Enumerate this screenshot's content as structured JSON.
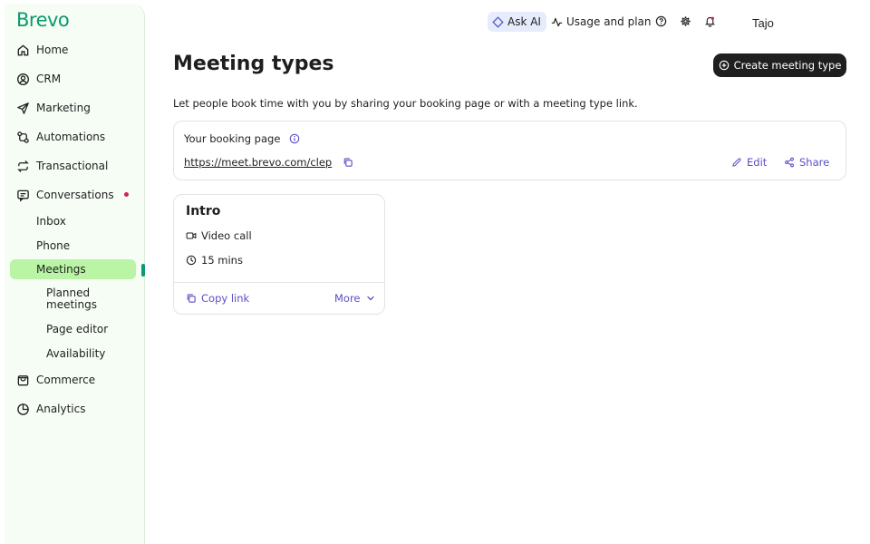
{
  "brand": {
    "logo": "Brevo",
    "color": "#0b996e"
  },
  "sidebar": {
    "items": [
      {
        "label": "Home",
        "icon": "home-icon"
      },
      {
        "label": "CRM",
        "icon": "contacts-icon"
      },
      {
        "label": "Marketing",
        "icon": "send-icon"
      },
      {
        "label": "Automations",
        "icon": "automation-icon"
      },
      {
        "label": "Transactional",
        "icon": "repeat-icon"
      },
      {
        "label": "Conversations",
        "icon": "chat-icon",
        "notification": true
      },
      {
        "label": "Commerce",
        "icon": "bag-icon"
      },
      {
        "label": "Analytics",
        "icon": "pie-chart-icon"
      }
    ],
    "conversations_sub": [
      {
        "label": "Inbox"
      },
      {
        "label": "Phone"
      },
      {
        "label": "Meetings",
        "active": true
      }
    ],
    "meetings_sub": [
      {
        "label": "Planned meetings"
      },
      {
        "label": "Page editor"
      },
      {
        "label": "Availability"
      }
    ]
  },
  "topbar": {
    "ask_ai": "Ask AI",
    "usage": "Usage and plan",
    "user": "Tajo"
  },
  "main": {
    "title": "Meeting types",
    "create_button": "Create meeting type",
    "description": "Let people book time with you by sharing your booking page or with a meeting type link.",
    "booking": {
      "label": "Your booking page",
      "url": "https://meet.brevo.com/clep",
      "edit": "Edit",
      "share": "Share"
    },
    "meeting_type": {
      "title": "Intro",
      "location": "Video call",
      "duration": "15 mins",
      "copy_link": "Copy link",
      "more": "More"
    }
  },
  "colors": {
    "accent": "#5b4fc8",
    "active_nav": "#b9f5a5",
    "notification": "#d0224c",
    "button_dark": "#1f1f1f"
  }
}
